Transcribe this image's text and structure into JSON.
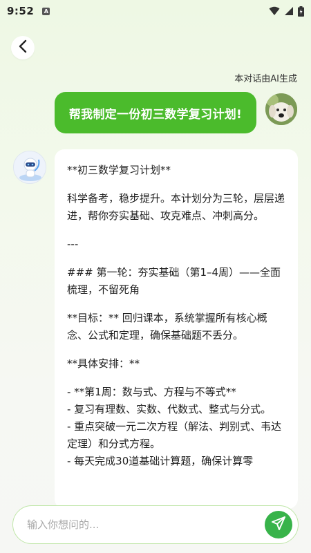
{
  "status_bar": {
    "time": "9:52",
    "app_icon_letter": "A",
    "icons": [
      "wifi-icon",
      "signal-icon",
      "battery-icon"
    ]
  },
  "header": {
    "back_icon": "chevron-left-icon"
  },
  "ai_note": "本对话由AI生成",
  "user_message": "帮我制定一份初三数学复习计划!",
  "bot_message": {
    "paragraphs": [
      "**初三数学复习计划**",
      "科学备考，稳步提升。本计划分为三轮，层层递进，帮你夯实基础、攻克难点、冲刺高分。",
      "---",
      "### 第一轮：夯实基础（第1–4周）——全面梳理，不留死角",
      "**目标：** 回归课本，系统掌握所有核心概念、公式和定理，确保基础题不丢分。",
      "**具体安排：**",
      "- **第1周：数与式、方程与不等式**",
      "  - 复习有理数、实数、代数式、整式与分式。",
      "  - 重点突破一元二次方程（解法、判别式、韦达定理）和分式方程。",
      "  - 每天完成30道基础计算题，确保计算零"
    ]
  },
  "input": {
    "placeholder": "输入你想问的..."
  },
  "colors": {
    "user_bubble": "#4bbb2c",
    "send_button": "#38b34a"
  }
}
